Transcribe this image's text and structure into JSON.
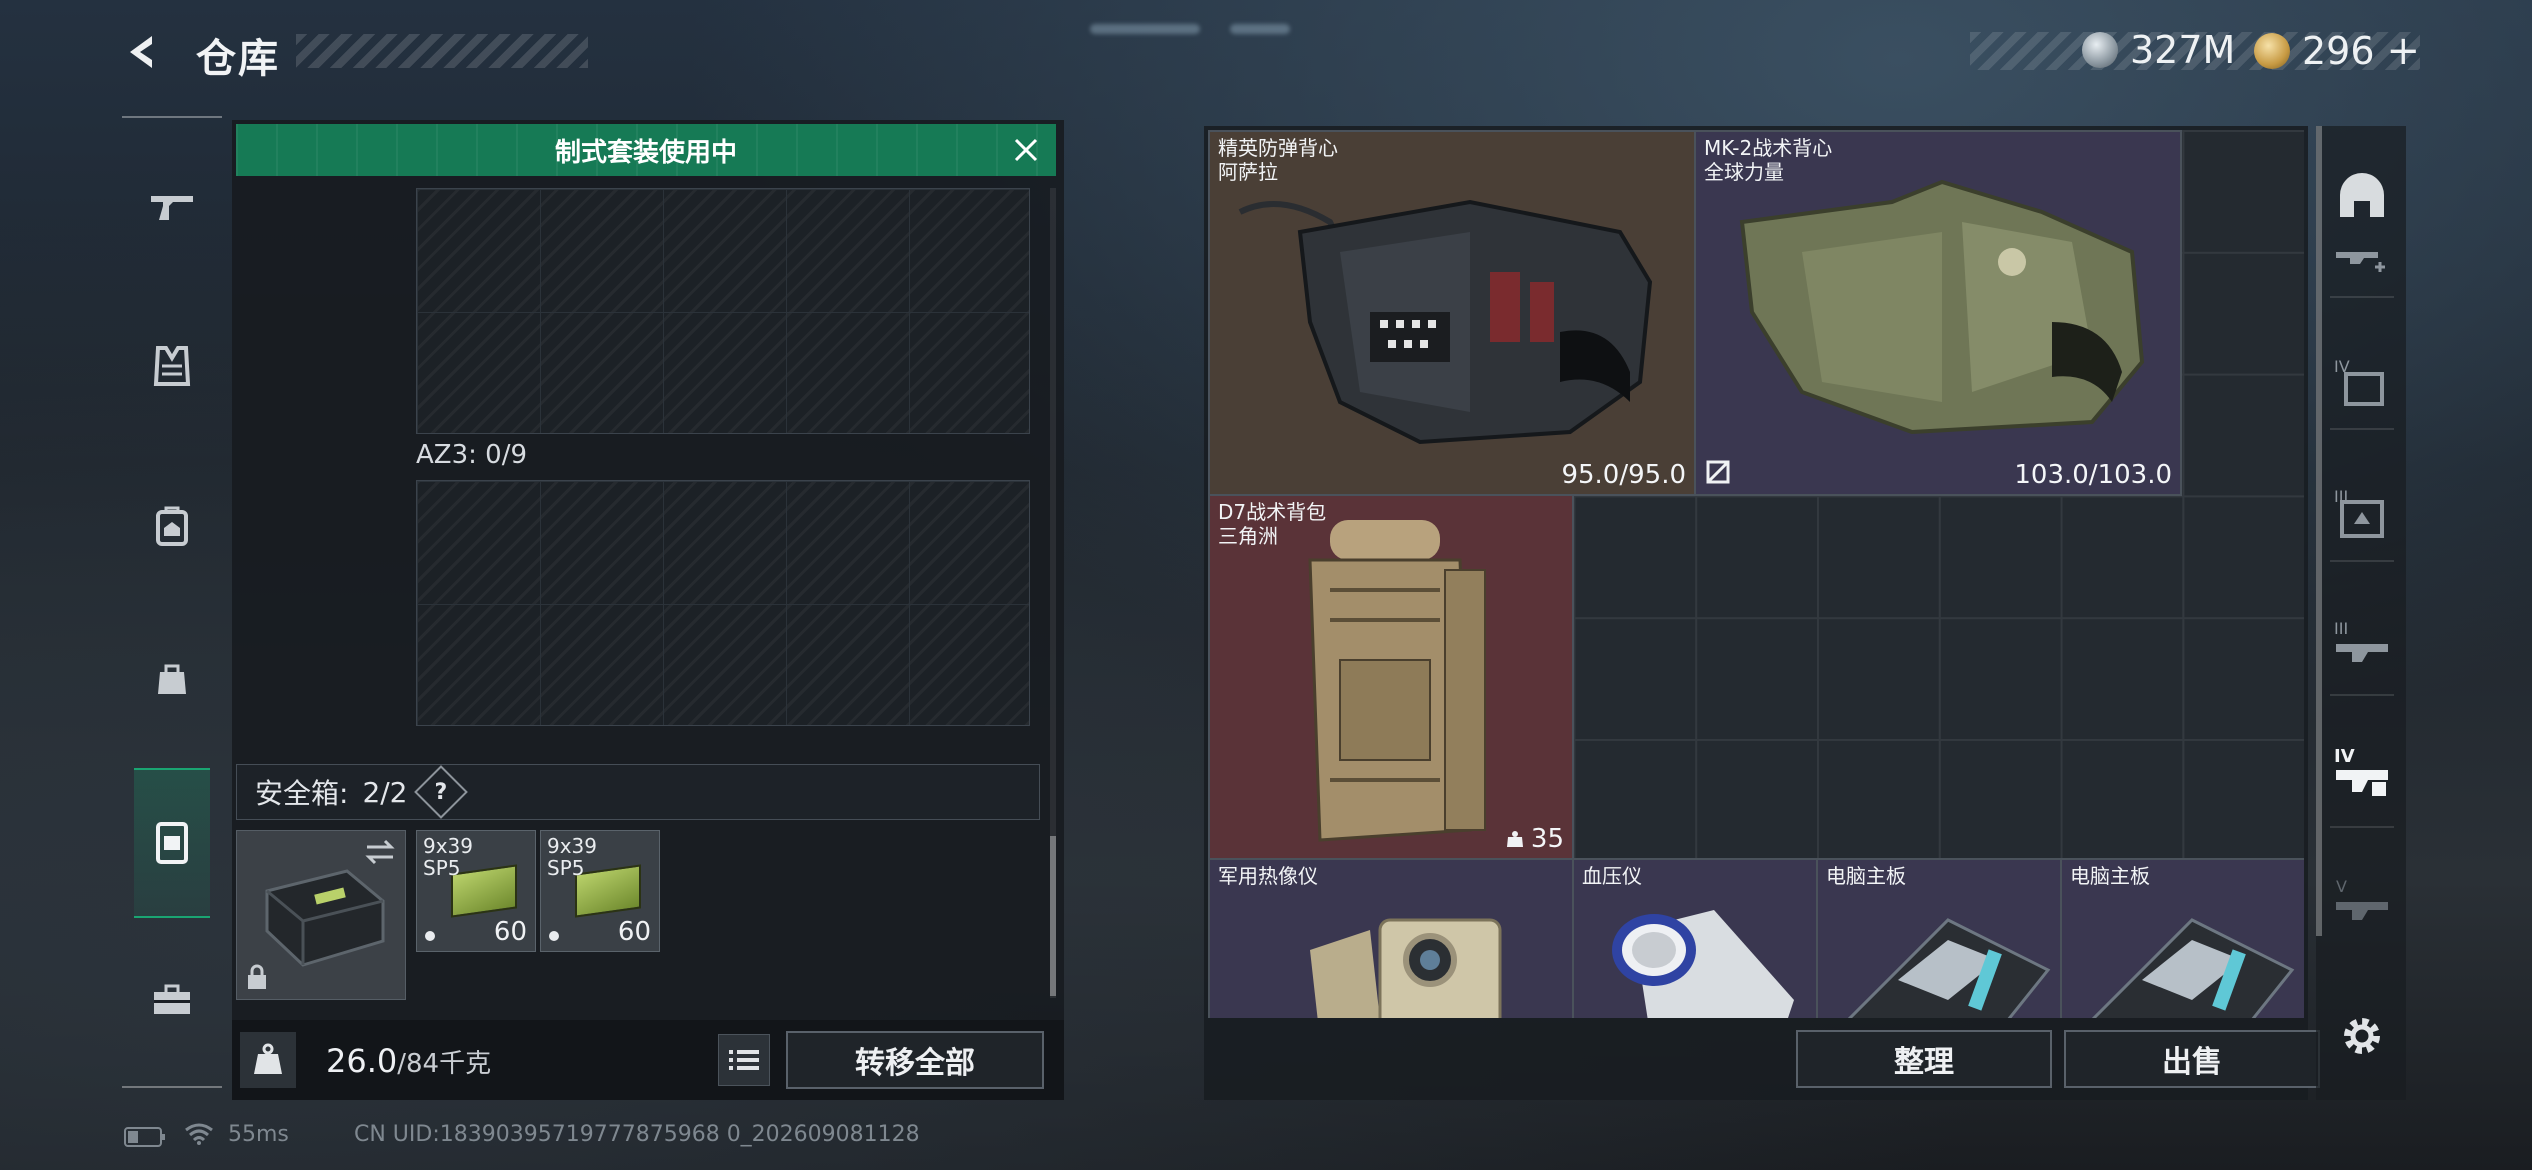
{
  "header": {
    "title": "仓库"
  },
  "currency": {
    "silver": "327M",
    "gold": "296",
    "gold_add": "+"
  },
  "banner": {
    "text": "制式套装使用中"
  },
  "left_panel": {
    "slot_label": "AZ3: 0/9",
    "safe_box_label": "安全箱:",
    "safe_box_count": "2/2",
    "help_label": "?",
    "ammo": [
      {
        "name_line1": "9x39",
        "name_line2": "SP5",
        "count": "60"
      },
      {
        "name_line1": "9x39",
        "name_line2": "SP5",
        "count": "60"
      }
    ],
    "weight_current": "26.0",
    "weight_max": "/84千克",
    "transfer_all": "转移全部"
  },
  "items": [
    {
      "name": "精英防弹背心",
      "sub": "阿萨拉",
      "durability": "95.0/95.0"
    },
    {
      "name": "MK-2战术背心",
      "sub": "全球力量",
      "durability": "103.0/103.0"
    },
    {
      "name": "D7战术背包",
      "sub": "三角洲",
      "capacity": "35"
    },
    {
      "name": "军用热像仪"
    },
    {
      "name": "血压仪"
    },
    {
      "name": "电脑主板"
    },
    {
      "name": "电脑主板"
    }
  ],
  "footer": {
    "sort": "整理",
    "sell": "出售"
  },
  "status_bar": {
    "ping": "55ms",
    "uid": "CN UID:18390395719777875968 0_202609081128"
  },
  "colors": {
    "accent_green": "#167a55",
    "rarity_brown": "#4a3f36",
    "rarity_purple": "#3a3750",
    "rarity_red": "#5a3338"
  }
}
